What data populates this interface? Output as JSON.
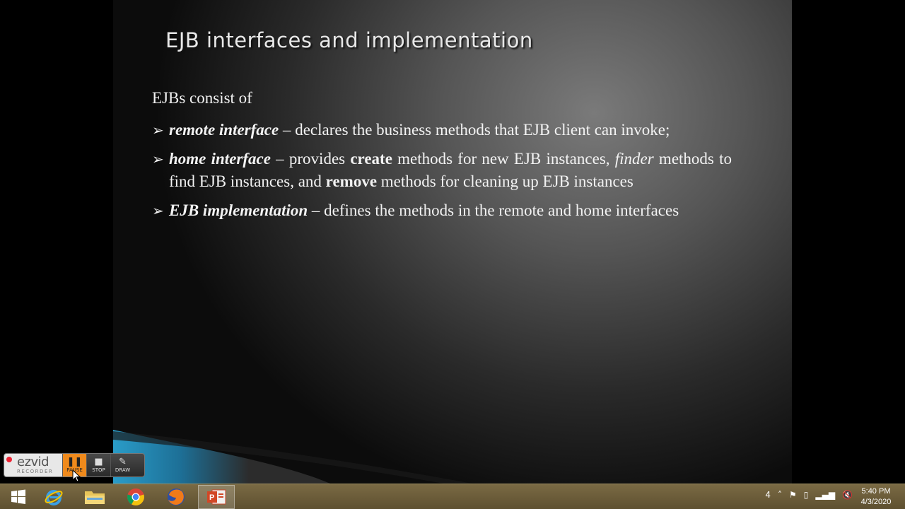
{
  "slide": {
    "title": "EJB interfaces and implementation",
    "intro": "EJBs consist of",
    "bullets": [
      {
        "parts": [
          {
            "text": "remote interface",
            "style": "term"
          },
          {
            "text": " – declares the business methods that EJB client can invoke;",
            "style": "normal"
          }
        ]
      },
      {
        "parts": [
          {
            "text": "home interface",
            "style": "term"
          },
          {
            "text": " – provides ",
            "style": "normal"
          },
          {
            "text": "create",
            "style": "strong"
          },
          {
            "text": " methods for new EJB instances, ",
            "style": "normal"
          },
          {
            "text": "finder",
            "style": "em"
          },
          {
            "text": " methods to find EJB instances, and ",
            "style": "normal"
          },
          {
            "text": "remove",
            "style": "strong"
          },
          {
            "text": " methods for cleaning up EJB instances",
            "style": "normal"
          }
        ]
      },
      {
        "parts": [
          {
            "text": "EJB implementation",
            "style": "term"
          },
          {
            "text": " – defines the methods in the remote and home interfaces",
            "style": "normal"
          }
        ]
      }
    ]
  },
  "recorder": {
    "brand": "ezvid",
    "subtitle": "RECORDER",
    "pause_label": "PAUSE",
    "stop_label": "STOP",
    "draw_label": "DRAW"
  },
  "taskbar": {
    "items": [
      "start-icon",
      "internet-explorer-icon",
      "file-explorer-icon",
      "chrome-icon",
      "firefox-icon",
      "powerpoint-icon"
    ],
    "tray_number": "4",
    "time": "5:40 PM",
    "date": "4/3/2020"
  },
  "colors": {
    "taskbar": "#6b5c3a",
    "pause_accent": "#f08a1c",
    "slide_text": "#f2f2f2"
  }
}
